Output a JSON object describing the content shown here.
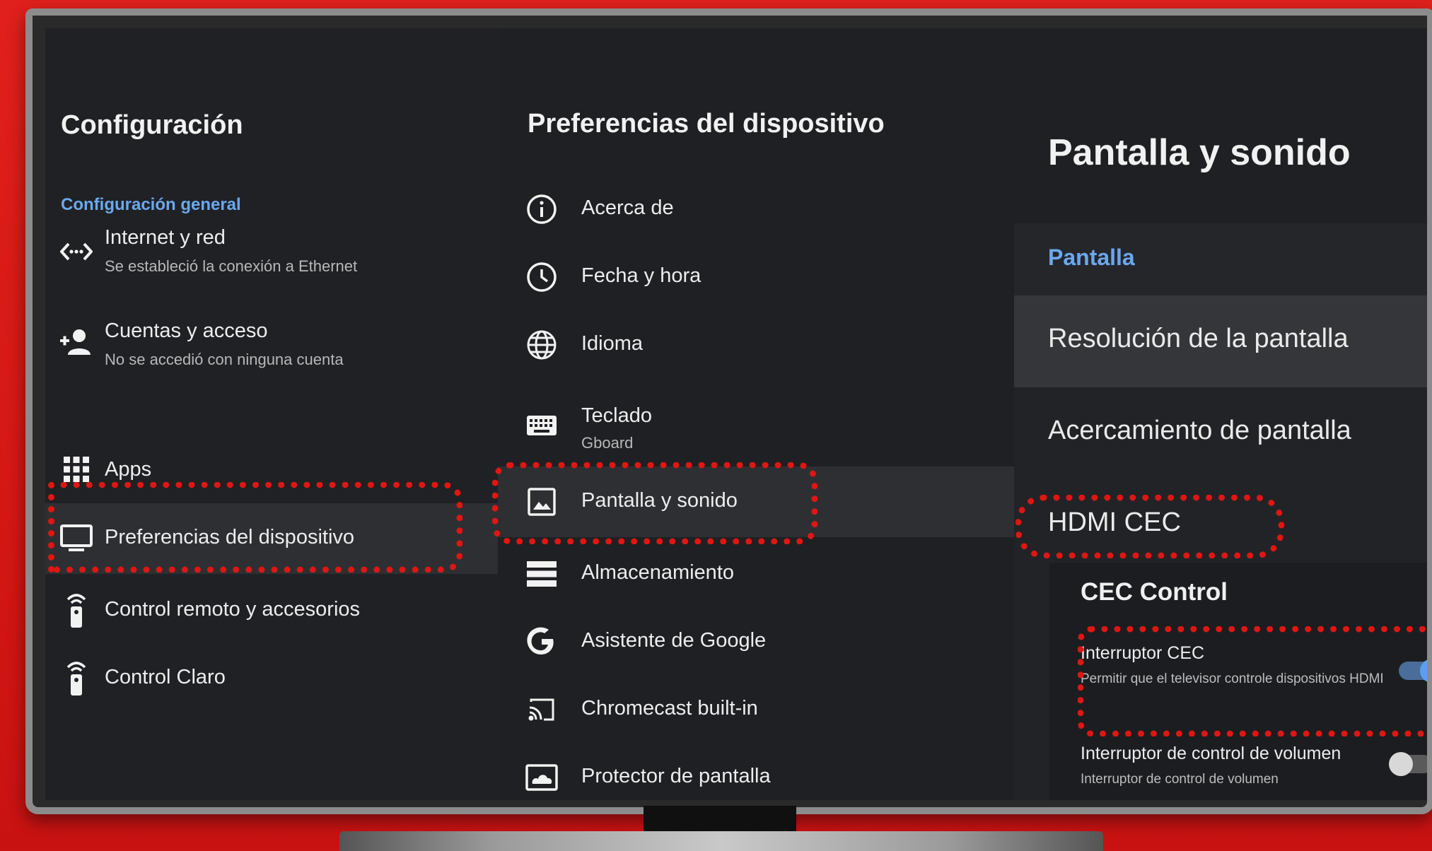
{
  "left": {
    "title": "Configuración",
    "section": "Configuración general",
    "items": [
      {
        "label": "Internet y red",
        "sub": "Se estableció la conexión a Ethernet",
        "icon": "network-icon"
      },
      {
        "label": "Cuentas y acceso",
        "sub": "No se accedió con ninguna cuenta",
        "icon": "add-person-icon"
      },
      {
        "label": "Apps",
        "icon": "apps-grid-icon"
      },
      {
        "label": "Preferencias del dispositivo",
        "icon": "tv-icon",
        "selected": true
      },
      {
        "label": "Control remoto y accesorios",
        "icon": "remote-icon"
      },
      {
        "label": "Control Claro",
        "icon": "remote-icon"
      }
    ]
  },
  "middle": {
    "title": "Preferencias del dispositivo",
    "items": [
      {
        "label": "Acerca de",
        "icon": "info-icon"
      },
      {
        "label": "Fecha y hora",
        "icon": "clock-icon"
      },
      {
        "label": "Idioma",
        "icon": "globe-icon"
      },
      {
        "label": "Teclado",
        "sub": "Gboard",
        "icon": "keyboard-icon"
      },
      {
        "label": "Pantalla y sonido",
        "icon": "image-icon",
        "selected": true
      },
      {
        "label": "Almacenamiento",
        "icon": "storage-icon"
      },
      {
        "label": "Asistente de Google",
        "icon": "google-icon"
      },
      {
        "label": "Chromecast built-in",
        "icon": "cast-icon"
      },
      {
        "label": "Protector de pantalla",
        "icon": "screensaver-icon"
      }
    ]
  },
  "right": {
    "title": "Pantalla y sonido",
    "section": "Pantalla",
    "items": [
      {
        "label": "Resolución de la pantalla",
        "selected": true
      },
      {
        "label": "Acercamiento de pantalla"
      },
      {
        "label": "HDMI CEC"
      }
    ],
    "cec": {
      "title": "CEC Control",
      "switch_label": "Interruptor CEC",
      "switch_sub": "Permitir que el televisor controle dispositivos HDMI",
      "switch_on": true,
      "volume_label": "Interruptor de control de volumen",
      "volume_sub": "Interruptor de control de volumen",
      "volume_on": false
    }
  },
  "colors": {
    "background_red": "#d41715",
    "highlight_dotted": "#e01612",
    "accent_blue": "#6aa8ef",
    "panel_dark": "#202124"
  }
}
